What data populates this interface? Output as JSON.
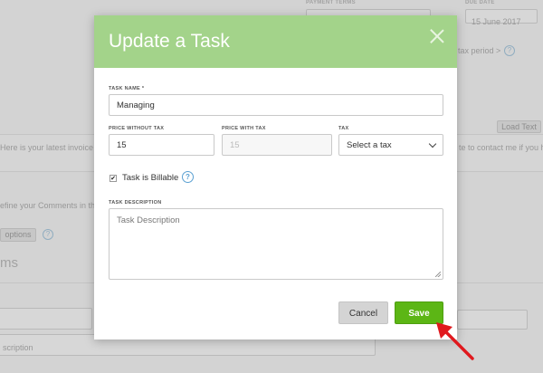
{
  "background": {
    "payment_terms_label": "PAYMENT TERMS",
    "due_date_label": "DUE DATE",
    "due_date_value": "15 June 2017",
    "tax_period_link": "tax period >",
    "load_text_button": "Load Text",
    "invoice_text_fragment": "Here is your latest invoice fo",
    "contact_text_fragment": "te to contact me if you h",
    "comments_fragment": "efine your Comments in th",
    "options_button": "options",
    "section_heading_fragment": "ms",
    "description_placeholder": "scription"
  },
  "modal": {
    "title": "Update a Task",
    "task_name": {
      "label": "TASK NAME *",
      "value": "Managing"
    },
    "price_without_tax": {
      "label": "PRICE WITHOUT TAX",
      "value": "15"
    },
    "price_with_tax": {
      "label": "PRICE WITH TAX",
      "value": "15"
    },
    "tax": {
      "label": "TAX",
      "selected": "Select a tax"
    },
    "billable": {
      "label": "Task is Billable",
      "checked": true
    },
    "help_glyph": "?",
    "description": {
      "label": "TASK DESCRIPTION",
      "placeholder": "Task Description"
    },
    "cancel_label": "Cancel",
    "save_label": "Save"
  },
  "colors": {
    "header_green": "#a3d38a",
    "save_green": "#5cb615",
    "help_blue": "#5aa0d2",
    "arrow_red": "#e0191e"
  },
  "icons": {
    "close": "close-icon",
    "help": "help-icon",
    "chevron": "chevron-down-icon",
    "checkmark": "checkmark-icon",
    "annotation_arrow": "arrow-icon"
  }
}
